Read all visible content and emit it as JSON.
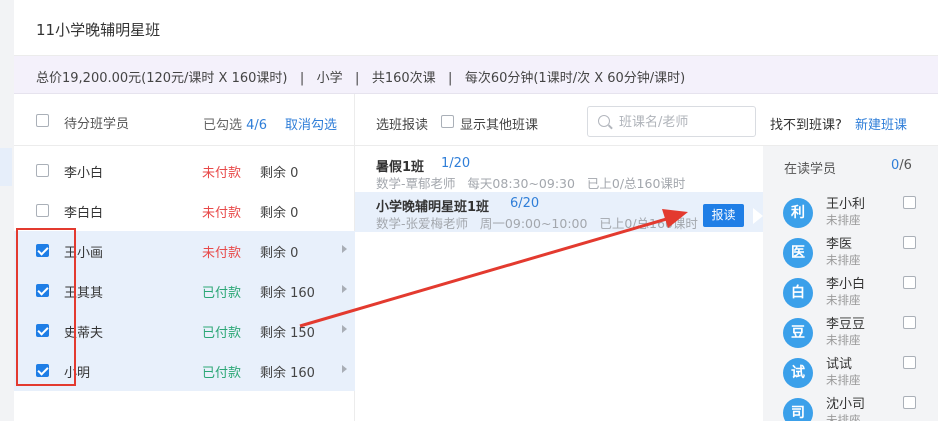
{
  "dialog": {
    "title": "11小学晚辅明星班",
    "info": "总价19,200.00元(120元/课时 X 160课时)   |   小学   |   共160次课   |   每次60分钟(1课时/次 X 60分钟/课时)"
  },
  "students": {
    "header_label": "待分班学员",
    "picked_prefix": "已勾选 ",
    "picked_count": "4",
    "picked_total": "/6",
    "cancel_label": "取消勾选",
    "rows": [
      {
        "name": "李小白",
        "status": "未付款",
        "remain": "剩余 0",
        "checked": false
      },
      {
        "name": "李白白",
        "status": "未付款",
        "remain": "剩余 0",
        "checked": false
      },
      {
        "name": "王小画",
        "status": "未付款",
        "remain": "剩余 0",
        "checked": true
      },
      {
        "name": "王其其",
        "status": "已付款",
        "remain": "剩余 160",
        "checked": true
      },
      {
        "name": "史蒂夫",
        "status": "已付款",
        "remain": "剩余 150",
        "checked": true
      },
      {
        "name": "小明",
        "status": "已付款",
        "remain": "剩余 160",
        "checked": true
      }
    ]
  },
  "classes": {
    "header_label": "选班报读",
    "show_other_label": "显示其他班课",
    "search_placeholder": "班课名/老师",
    "not_found_label": "找不到班课?",
    "new_class_label": "新建班课",
    "enroll_label": "报读",
    "rows": [
      {
        "name": "暑假1班",
        "capacity": "1/20",
        "meta": "数学-覃郁老师   每天08:30~09:30   已上0/总160课时"
      },
      {
        "name": "小学晚辅明星班1班",
        "capacity": "6/20",
        "meta": "数学-张爱梅老师   周一09:00~10:00   已上0/总160课时"
      }
    ]
  },
  "reading": {
    "header_label": "在读学员",
    "count": "0",
    "total": "/6",
    "items": [
      {
        "avatar": "利",
        "name": "王小利",
        "seat": "未排座"
      },
      {
        "avatar": "医",
        "name": "李医",
        "seat": "未排座"
      },
      {
        "avatar": "白",
        "name": "李小白",
        "seat": "未排座"
      },
      {
        "avatar": "豆",
        "name": "李豆豆",
        "seat": "未排座"
      },
      {
        "avatar": "试",
        "name": "试试",
        "seat": "未排座"
      },
      {
        "avatar": "司",
        "name": "沈小司",
        "seat": "未排座"
      }
    ]
  },
  "colors": {
    "primary": "#1f7ee6",
    "unpaid": "#e84a4a",
    "paid": "#2ca776",
    "annotation": "#e33a2f"
  }
}
